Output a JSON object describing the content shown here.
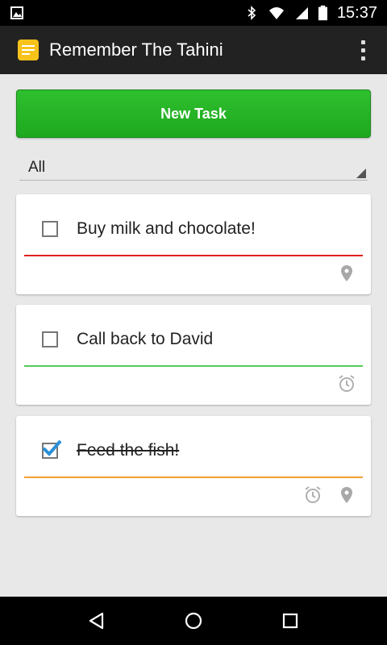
{
  "status_bar": {
    "time": "15:37",
    "icons": [
      "image-icon",
      "bluetooth-icon",
      "wifi-icon",
      "signal-icon",
      "battery-icon"
    ]
  },
  "app": {
    "title": "Remember The Tahini",
    "icon": "notepad-icon",
    "menu_icon": "overflow-menu-icon",
    "accent": "#f7c31a"
  },
  "new_task_button": {
    "label": "New Task",
    "color": "#22b022"
  },
  "filter": {
    "selected": "All"
  },
  "tasks": [
    {
      "text": "Buy milk and chocolate!",
      "checked": false,
      "underline_color": "#e02020",
      "icons": [
        "location-pin-icon"
      ]
    },
    {
      "text": "Call back to David",
      "checked": false,
      "underline_color": "#55cc55",
      "icons": [
        "alarm-clock-icon"
      ]
    },
    {
      "text": "Feed the fish!",
      "checked": true,
      "underline_color": "#f0a030",
      "icons": [
        "alarm-clock-icon",
        "location-pin-icon"
      ]
    }
  ],
  "nav_bar": {
    "buttons": [
      "back-icon",
      "home-icon",
      "recents-icon"
    ]
  }
}
